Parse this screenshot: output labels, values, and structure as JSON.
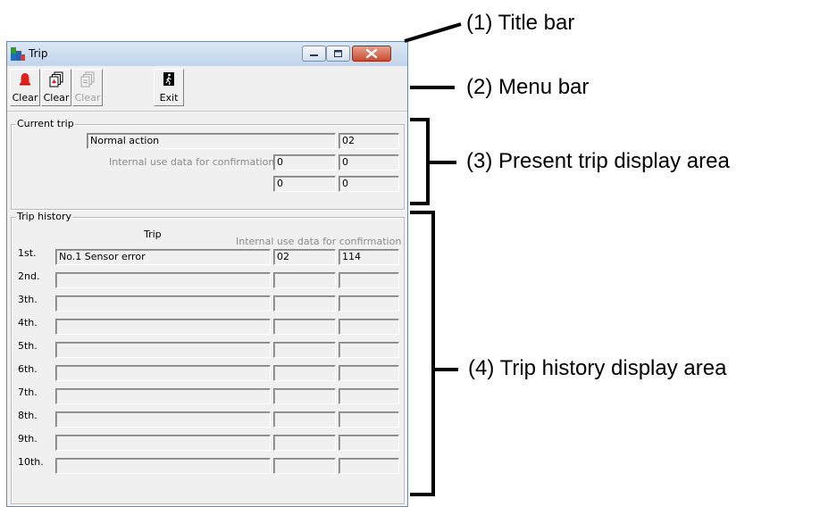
{
  "window": {
    "title": "Trip"
  },
  "toolbar": {
    "buttons": [
      {
        "label": "Clear",
        "icon": "red-bell-icon",
        "enabled": true
      },
      {
        "label": "Clear",
        "icon": "stacked-pages-icon",
        "enabled": true
      },
      {
        "label": "Clear",
        "icon": "stacked-pages-icon",
        "enabled": false
      },
      {
        "label": "Exit",
        "icon": "exit-door-icon",
        "enabled": true
      }
    ]
  },
  "current_trip": {
    "title": "Current trip",
    "trip_name": "Normal action",
    "trip_code": "02",
    "internal_label": "Internal use data for confirmation",
    "data": [
      "0",
      "0",
      "0",
      "0"
    ]
  },
  "trip_history": {
    "title": "Trip history",
    "col_trip": "Trip",
    "col_internal": "Internal use data for confirmation",
    "rows": [
      {
        "label": "1st.",
        "trip": "No.1  Sensor error",
        "d1": "02",
        "d2": "114"
      },
      {
        "label": "2nd.",
        "trip": "",
        "d1": "",
        "d2": ""
      },
      {
        "label": "3th.",
        "trip": "",
        "d1": "",
        "d2": ""
      },
      {
        "label": "4th.",
        "trip": "",
        "d1": "",
        "d2": ""
      },
      {
        "label": "5th.",
        "trip": "",
        "d1": "",
        "d2": ""
      },
      {
        "label": "6th.",
        "trip": "",
        "d1": "",
        "d2": ""
      },
      {
        "label": "7th.",
        "trip": "",
        "d1": "",
        "d2": ""
      },
      {
        "label": "8th.",
        "trip": "",
        "d1": "",
        "d2": ""
      },
      {
        "label": "9th.",
        "trip": "",
        "d1": "",
        "d2": ""
      },
      {
        "label": "10th.",
        "trip": "",
        "d1": "",
        "d2": ""
      }
    ]
  },
  "annotations": {
    "title_bar": "(1) Title bar",
    "menu_bar": "(2) Menu bar",
    "present_trip": "(3) Present trip display area",
    "trip_history": "(4) Trip history display area"
  }
}
